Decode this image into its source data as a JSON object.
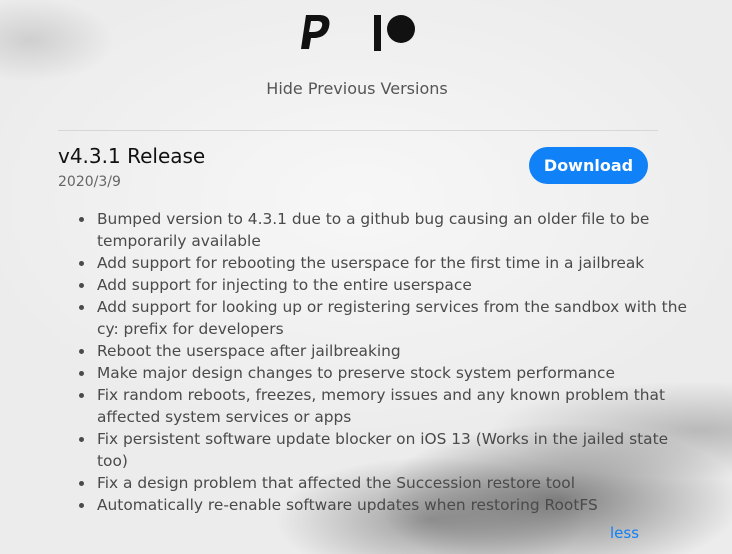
{
  "header": {
    "icons": [
      "paypal-icon",
      "patreon-icon"
    ],
    "toggle_label": "Hide Previous Versions"
  },
  "release": {
    "title": "v4.3.1 Release",
    "date": "2020/3/9",
    "download_label": "Download",
    "changes": [
      "Bumped version to 4.3.1 due to a github bug causing an older file to be temporarily available",
      "Add support for rebooting the userspace for the first time in a jailbreak",
      "Add support for injecting to the entire userspace",
      "Add support for looking up or registering services from the sandbox with the cy: prefix for developers",
      "Reboot the userspace after jailbreaking",
      "Make major design changes to preserve stock system performance",
      "Fix random reboots, freezes, memory issues and any known problem that affected system services or apps",
      "Fix persistent software update blocker on iOS 13 (Works in the jailed state too)",
      "Fix a design problem that affected the Succession restore tool",
      "Automatically re-enable software updates when restoring RootFS"
    ],
    "less_label": "less"
  },
  "colors": {
    "accent": "#1081f6",
    "text": "#4a4a4a",
    "title": "#111111"
  }
}
